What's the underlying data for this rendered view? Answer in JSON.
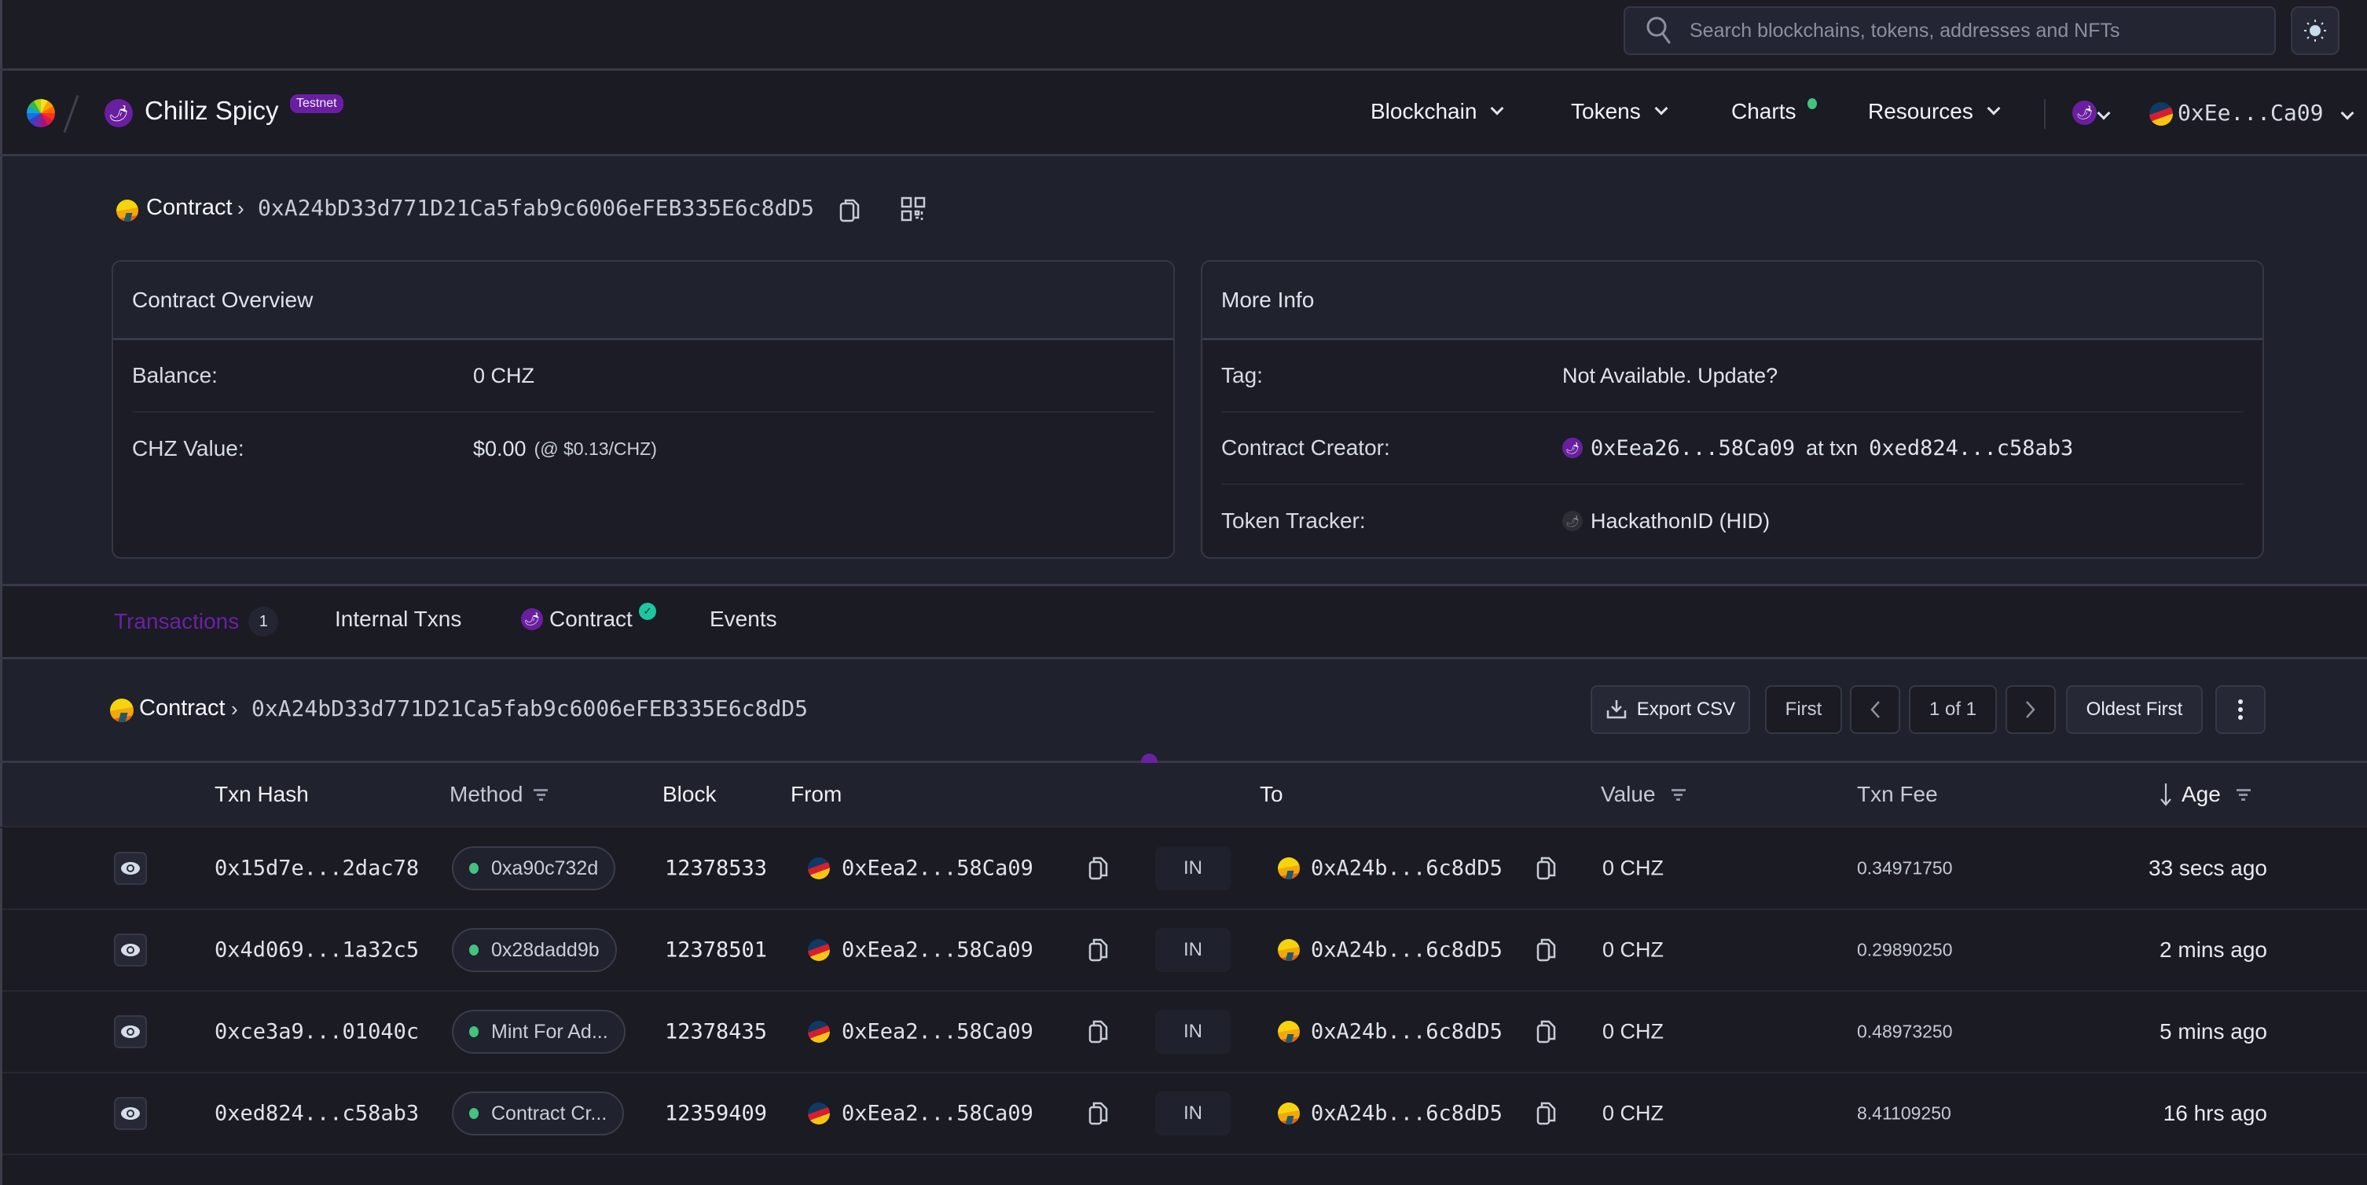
{
  "search": {
    "placeholder": "Search blockchains, tokens, addresses and NFTs"
  },
  "header": {
    "network_name": "Chiliz Spicy",
    "network_badge": "Testnet",
    "nav": [
      {
        "label": "Blockchain",
        "has_dropdown": true
      },
      {
        "label": "Tokens",
        "has_dropdown": true
      },
      {
        "label": "Charts",
        "has_dropdown": false,
        "notification_dot": true
      },
      {
        "label": "Resources",
        "has_dropdown": true
      }
    ],
    "wallet_address": "0xEe...Ca09"
  },
  "breadcrumb": {
    "type_label": "Contract",
    "separator": "›",
    "address": "0xA24bD33d771D21Ca5fab9c6006eFEB335E6c8dD5"
  },
  "overview_card": {
    "title": "Contract Overview",
    "rows": [
      {
        "label": "Balance:",
        "value": "0 CHZ",
        "extra": ""
      },
      {
        "label": "CHZ Value:",
        "value": "$0.00",
        "extra": "(@ $0.13/CHZ)"
      }
    ]
  },
  "more_info_card": {
    "title": "More Info",
    "tag_label": "Tag:",
    "tag_value": "Not Available. Update?",
    "creator_label": "Contract Creator:",
    "creator_address": "0xEea26...58Ca09",
    "creator_at": "at txn",
    "creator_txn": "0xed824...c58ab3",
    "tracker_label": "Token Tracker:",
    "tracker_value": "HackathonID (HID)"
  },
  "tabs": [
    {
      "label": "Transactions",
      "count": "1",
      "active": true
    },
    {
      "label": "Internal Txns",
      "active": false
    },
    {
      "label": "Contract",
      "verified": true,
      "active": false
    },
    {
      "label": "Events",
      "active": false
    }
  ],
  "list_header": {
    "type_label": "Contract",
    "separator": "›",
    "address": "0xA24bD33d771D21Ca5fab9c6006eFEB335E6c8dD5"
  },
  "toolbar": {
    "export_label": "Export CSV",
    "first_label": "First",
    "page_info": "1 of 1",
    "sort_label": "Oldest First"
  },
  "table": {
    "columns": [
      "Txn Hash",
      "Method",
      "Block",
      "From",
      "To",
      "Value",
      "Txn Fee",
      "Age"
    ],
    "rows": [
      {
        "hash": "0x15d7e...2dac78",
        "method": "0xa90c732d",
        "block": "12378533",
        "from": "0xEea2...58Ca09",
        "direction": "IN",
        "to": "0xA24b...6c8dD5",
        "value": "0 CHZ",
        "fee": "0.34971750",
        "age": "33 secs ago"
      },
      {
        "hash": "0x4d069...1a32c5",
        "method": "0x28dadd9b",
        "block": "12378501",
        "from": "0xEea2...58Ca09",
        "direction": "IN",
        "to": "0xA24b...6c8dD5",
        "value": "0 CHZ",
        "fee": "0.29890250",
        "age": "2 mins ago"
      },
      {
        "hash": "0xce3a9...01040c",
        "method": "Mint For Ad...",
        "block": "12378435",
        "from": "0xEea2...58Ca09",
        "direction": "IN",
        "to": "0xA24b...6c8dD5",
        "value": "0 CHZ",
        "fee": "0.48973250",
        "age": "5 mins ago"
      },
      {
        "hash": "0xed824...c58ab3",
        "method": "Contract Cr...",
        "block": "12359409",
        "from": "0xEea2...58Ca09",
        "direction": "IN",
        "to": "0xA24b...6c8dD5",
        "value": "0 CHZ",
        "fee": "8.41109250",
        "age": "16 hrs ago"
      }
    ]
  },
  "colors": {
    "accent_purple": "#6c21a4",
    "success_green": "#44c27f",
    "verified_teal": "#1ec5a0",
    "background": "#1a1b23"
  }
}
